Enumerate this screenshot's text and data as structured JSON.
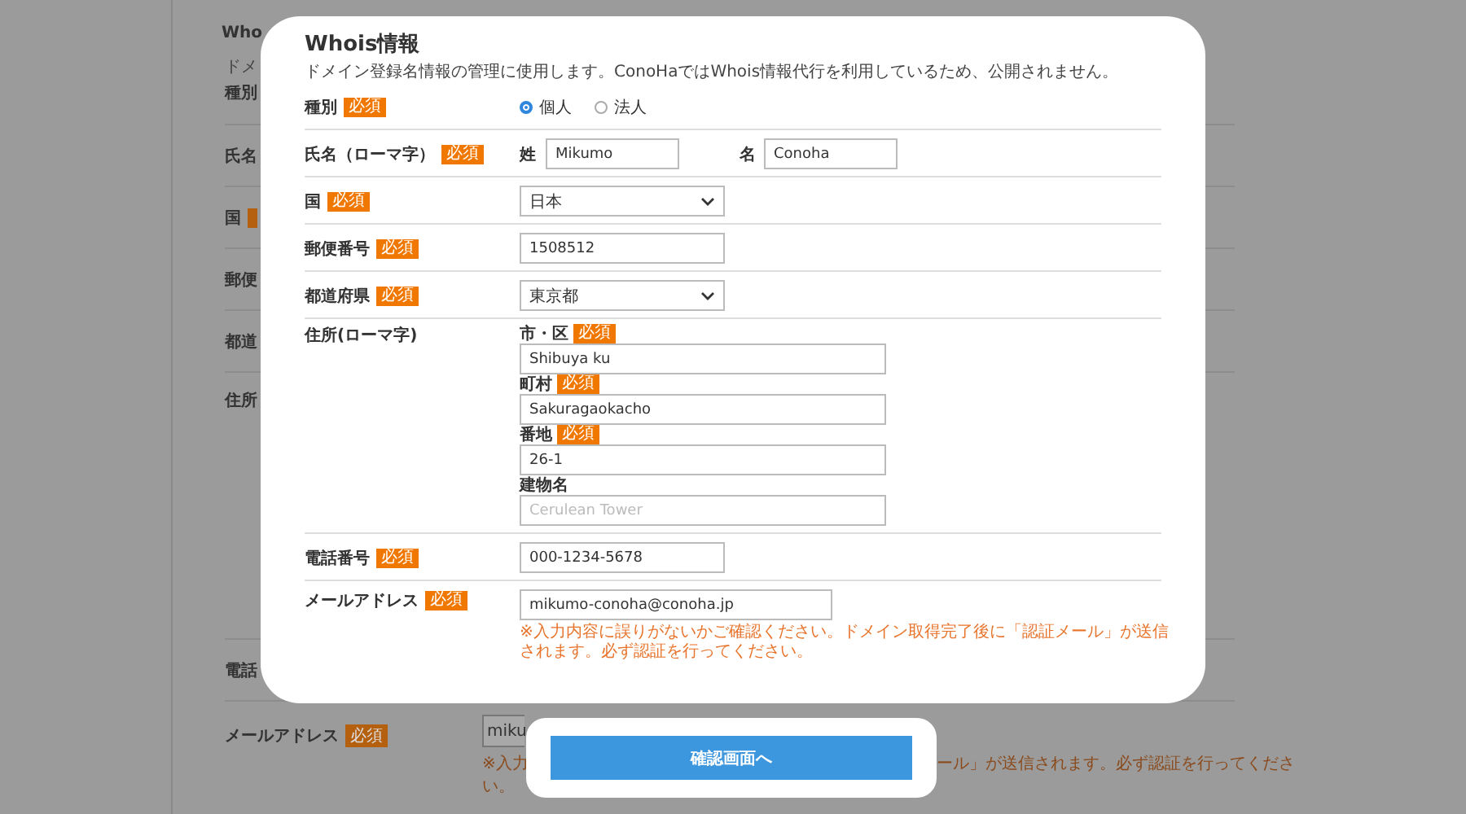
{
  "background_page": {
    "title": "Who",
    "description": "ドメ",
    "rows": [
      {
        "label": "種別"
      },
      {
        "label": "氏名"
      },
      {
        "label": "国",
        "required": true
      },
      {
        "label": "郵便"
      },
      {
        "label": "都道"
      },
      {
        "label": "住所"
      },
      {
        "label": "電話"
      }
    ],
    "email_row": {
      "label": "メールアドレス",
      "badge": "必須",
      "value": "miku",
      "note_start": "※入力",
      "note_end": "ール」が送信されます。必ず認証を行ってくださ",
      "note_last": "い。"
    }
  },
  "whois_card": {
    "title": "Whois情報",
    "description": "ドメイン登録名情報の管理に使用します。ConoHaではWhois情報代行を利用しているため、公開されません。",
    "rows": [
      {
        "kind": "radio",
        "label": "種別",
        "badge": "必須",
        "options": [
          {
            "label": "個人",
            "selected": true
          },
          {
            "label": "法人",
            "selected": false
          }
        ]
      },
      {
        "kind": "name",
        "label": "氏名（ローマ字）",
        "badge": "必須",
        "parts": [
          {
            "label": "姓",
            "value": "Mikumo"
          },
          {
            "label": "名",
            "value": "Conoha"
          }
        ]
      },
      {
        "kind": "select",
        "label": "国",
        "badge": "必須",
        "value": "日本"
      },
      {
        "kind": "text",
        "label": "郵便番号",
        "badge": "必須",
        "value": "1508512"
      },
      {
        "kind": "select",
        "label": "都道府県",
        "badge": "必須",
        "value": "東京都"
      },
      {
        "kind": "address",
        "label": "住所(ローマ字)",
        "parts": [
          {
            "label": "市・区",
            "badge": "必須",
            "value": "Shibuya ku"
          },
          {
            "label": "町村",
            "badge": "必須",
            "value": "Sakuragaokacho"
          },
          {
            "label": "番地",
            "badge": "必須",
            "value": "26-1"
          },
          {
            "label": "建物名",
            "placeholder": "Cerulean Tower"
          }
        ]
      },
      {
        "kind": "text",
        "label": "電話番号",
        "badge": "必須",
        "value": "000-1234-5678"
      },
      {
        "kind": "text",
        "label": "メールアドレス",
        "badge": "必須",
        "value": "mikumo-conoha@conoha.jp",
        "note": "※入力内容に誤りがないかご確認ください。ドメイン取得完了後に「認証メール」が送信されます。必ず認証を行ってください。"
      }
    ]
  },
  "confirm_button": {
    "label": "確認画面へ"
  }
}
